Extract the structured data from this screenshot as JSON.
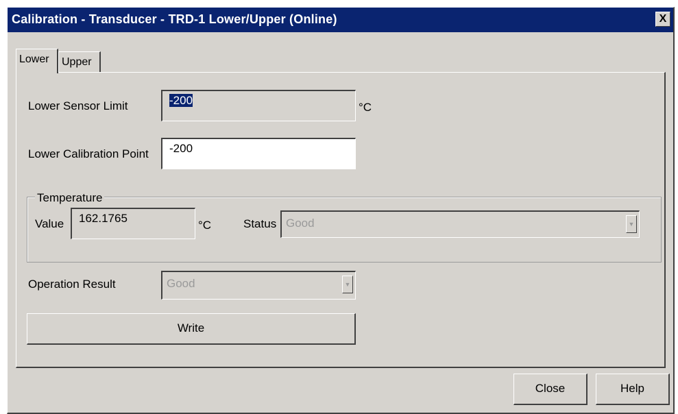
{
  "window": {
    "title": "Calibration - Transducer - TRD-1 Lower/Upper  (Online)",
    "close_glyph": "X"
  },
  "tabs": [
    {
      "label": "Lower",
      "active": true
    },
    {
      "label": "Upper",
      "active": false
    }
  ],
  "lower_sensor_limit": {
    "label": "Lower Sensor Limit",
    "value": "-200",
    "unit": "°C"
  },
  "lower_calibration_point": {
    "label": "Lower Calibration Point",
    "value": "-200"
  },
  "temperature": {
    "group_label": "Temperature",
    "value_label": "Value",
    "value": "162.1765",
    "unit": "°C",
    "status_label": "Status",
    "status_value": "Good"
  },
  "operation_result": {
    "label": "Operation Result",
    "value": "Good"
  },
  "buttons": {
    "write": "Write",
    "close": "Close",
    "help": "Help"
  },
  "icons": {
    "dropdown_arrow": "chevron-down-icon",
    "close": "close-icon"
  }
}
